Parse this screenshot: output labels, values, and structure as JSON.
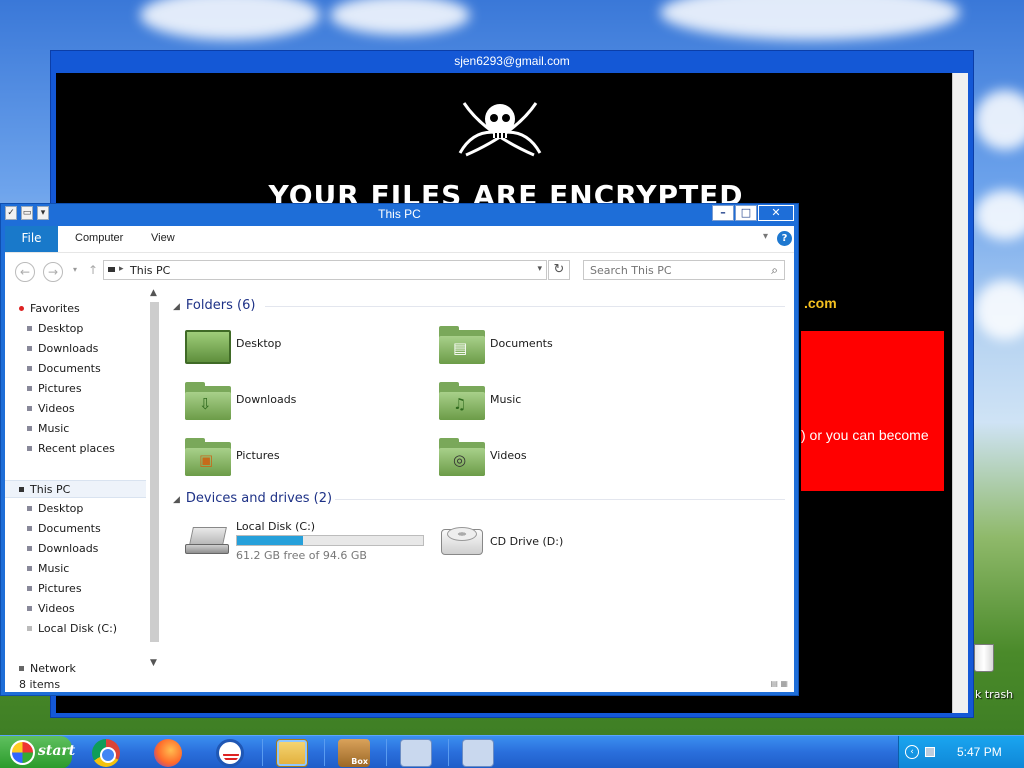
{
  "ransom_window": {
    "title": "sjen6293@gmail.com",
    "heading": "YOUR FILES ARE ENCRYPTED",
    "email_fragment": ".com",
    "red_box_text": ") or you can become"
  },
  "explorer": {
    "title": "This PC",
    "tabs": {
      "file": "File",
      "computer": "Computer",
      "view": "View"
    },
    "help_label": "?",
    "address": {
      "path": "This PC"
    },
    "search": {
      "placeholder": "Search This PC"
    },
    "nav": {
      "favorites": "Favorites",
      "fav_items": [
        "Desktop",
        "Downloads",
        "Documents",
        "Pictures",
        "Videos",
        "Music",
        "Recent places"
      ],
      "this_pc": "This PC",
      "pc_items": [
        "Desktop",
        "Documents",
        "Downloads",
        "Music",
        "Pictures",
        "Videos",
        "Local Disk (C:)"
      ],
      "network": "Network"
    },
    "folders_section": "Folders (6)",
    "folders": [
      "Desktop",
      "Documents",
      "Downloads",
      "Music",
      "Pictures",
      "Videos"
    ],
    "devices_section": "Devices and drives (2)",
    "drives": [
      {
        "name": "Local Disk (C:)",
        "free": "61.2 GB free of 94.6 GB",
        "used_fraction": 0.353
      },
      {
        "name": "CD Drive (D:)"
      }
    ],
    "status": "8 items"
  },
  "desktop": {
    "recycle_label": "k trash"
  },
  "taskbar": {
    "start_label": "start",
    "clock": "5:47 PM"
  }
}
